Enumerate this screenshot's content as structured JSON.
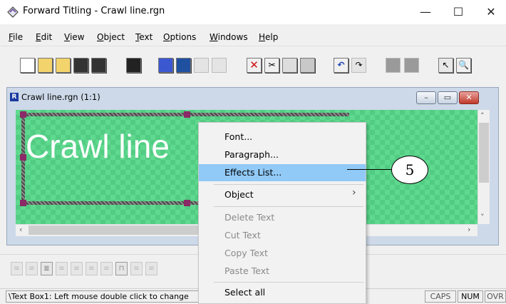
{
  "window": {
    "title": "Forward Titling - Crawl line.rgn",
    "controls": {
      "minimize": "—",
      "maximize": "☐",
      "close": "✕"
    }
  },
  "menubar": [
    {
      "label": "File",
      "key": "F",
      "rest": "ile"
    },
    {
      "label": "Edit",
      "key": "E",
      "rest": "dit"
    },
    {
      "label": "View",
      "key": "V",
      "rest": "iew"
    },
    {
      "label": "Object",
      "key": "O",
      "rest": "bject"
    },
    {
      "label": "Text",
      "key": "T",
      "rest": "ext"
    },
    {
      "label": "Options",
      "key": "O",
      "rest": "ptions"
    },
    {
      "label": "Windows",
      "key": "W",
      "rest": "indows"
    },
    {
      "label": "Help",
      "key": "H",
      "rest": "elp"
    }
  ],
  "toolbar": {
    "icons": [
      "new-icon",
      "open-icon",
      "open-folder-icon",
      "save-icon",
      "save-all-icon",
      "save-disk-icon",
      "transparency-icon",
      "import-icon",
      "disabled-a-icon",
      "disabled-b-icon",
      "delete-icon",
      "cut-icon",
      "copy-icon",
      "paste-icon",
      "undo-icon",
      "redo-icon",
      "disabled-c-icon",
      "disabled-d-icon",
      "pointer-icon",
      "zoom-icon"
    ]
  },
  "document": {
    "title": "Crawl line.rgn  (1:1)",
    "icon_letter": "R",
    "canvas_text": "Crawl line",
    "controls": {
      "minimize": "–",
      "restore": "▭",
      "close": "✕"
    }
  },
  "context_menu": {
    "items": [
      {
        "label": "Font...",
        "disabled": false
      },
      {
        "label": "Paragraph...",
        "disabled": false
      },
      {
        "label": "Effects List...",
        "disabled": false,
        "highlighted": true
      },
      {
        "label": "Object",
        "disabled": false,
        "submenu": true
      },
      {
        "label": "Delete Text",
        "disabled": true
      },
      {
        "label": "Cut Text",
        "disabled": true
      },
      {
        "label": "Copy Text",
        "disabled": true
      },
      {
        "label": "Paste Text",
        "disabled": true
      },
      {
        "label": "Select all",
        "disabled": false
      }
    ],
    "submenu_arrow": "›"
  },
  "callout": {
    "label": "5"
  },
  "status": {
    "text": "\\Text Box1: Left mouse double click to change",
    "panels": [
      "CAPS",
      "NUM",
      "OVR"
    ]
  },
  "colors": {
    "canvas": "#5fd98f",
    "highlight": "#91c9f7"
  }
}
